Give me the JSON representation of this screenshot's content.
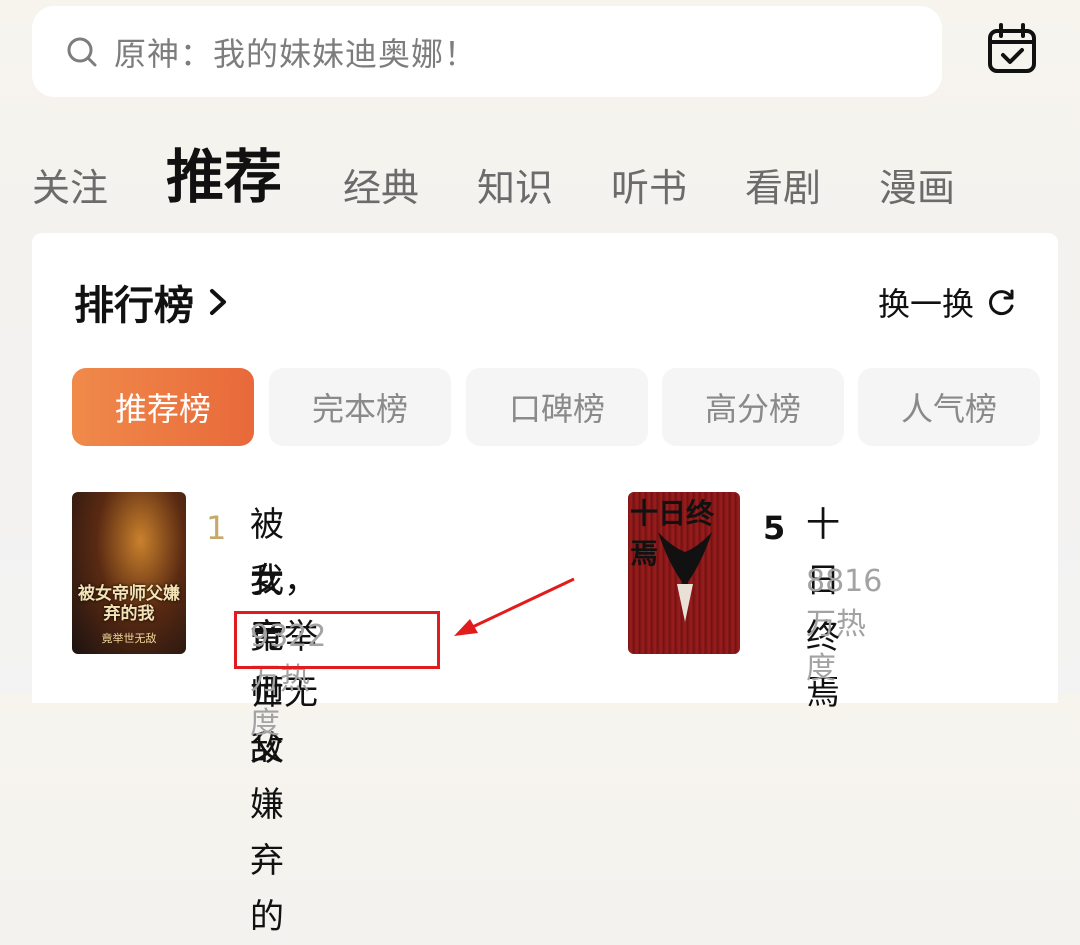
{
  "search": {
    "placeholder": "原神：我的妹妹迪奥娜！"
  },
  "tabs": [
    "关注",
    "推荐",
    "经典",
    "知识",
    "听书",
    "看剧",
    "漫画"
  ],
  "ranking": {
    "title": "排行榜",
    "refresh_label": "换一换",
    "chips": [
      "推荐榜",
      "完本榜",
      "口碑榜",
      "高分榜",
      "人气榜"
    ],
    "books": [
      {
        "rank": "1",
        "title_line1": "被女帝师父嫌弃的",
        "title_line2": "我，竟举世无敌",
        "heat": "9322万热度",
        "cover_text": "被女帝师父嫌弃的我",
        "cover_sub": "竟举世无敌"
      },
      {
        "rank": "5",
        "title_line1": "十日终焉",
        "heat": "8816万热度",
        "cover_text": "十日终焉"
      }
    ]
  },
  "colors": {
    "accent": "#e8693a",
    "highlight": "#e21c1c",
    "rank1": "#c8a86a"
  }
}
